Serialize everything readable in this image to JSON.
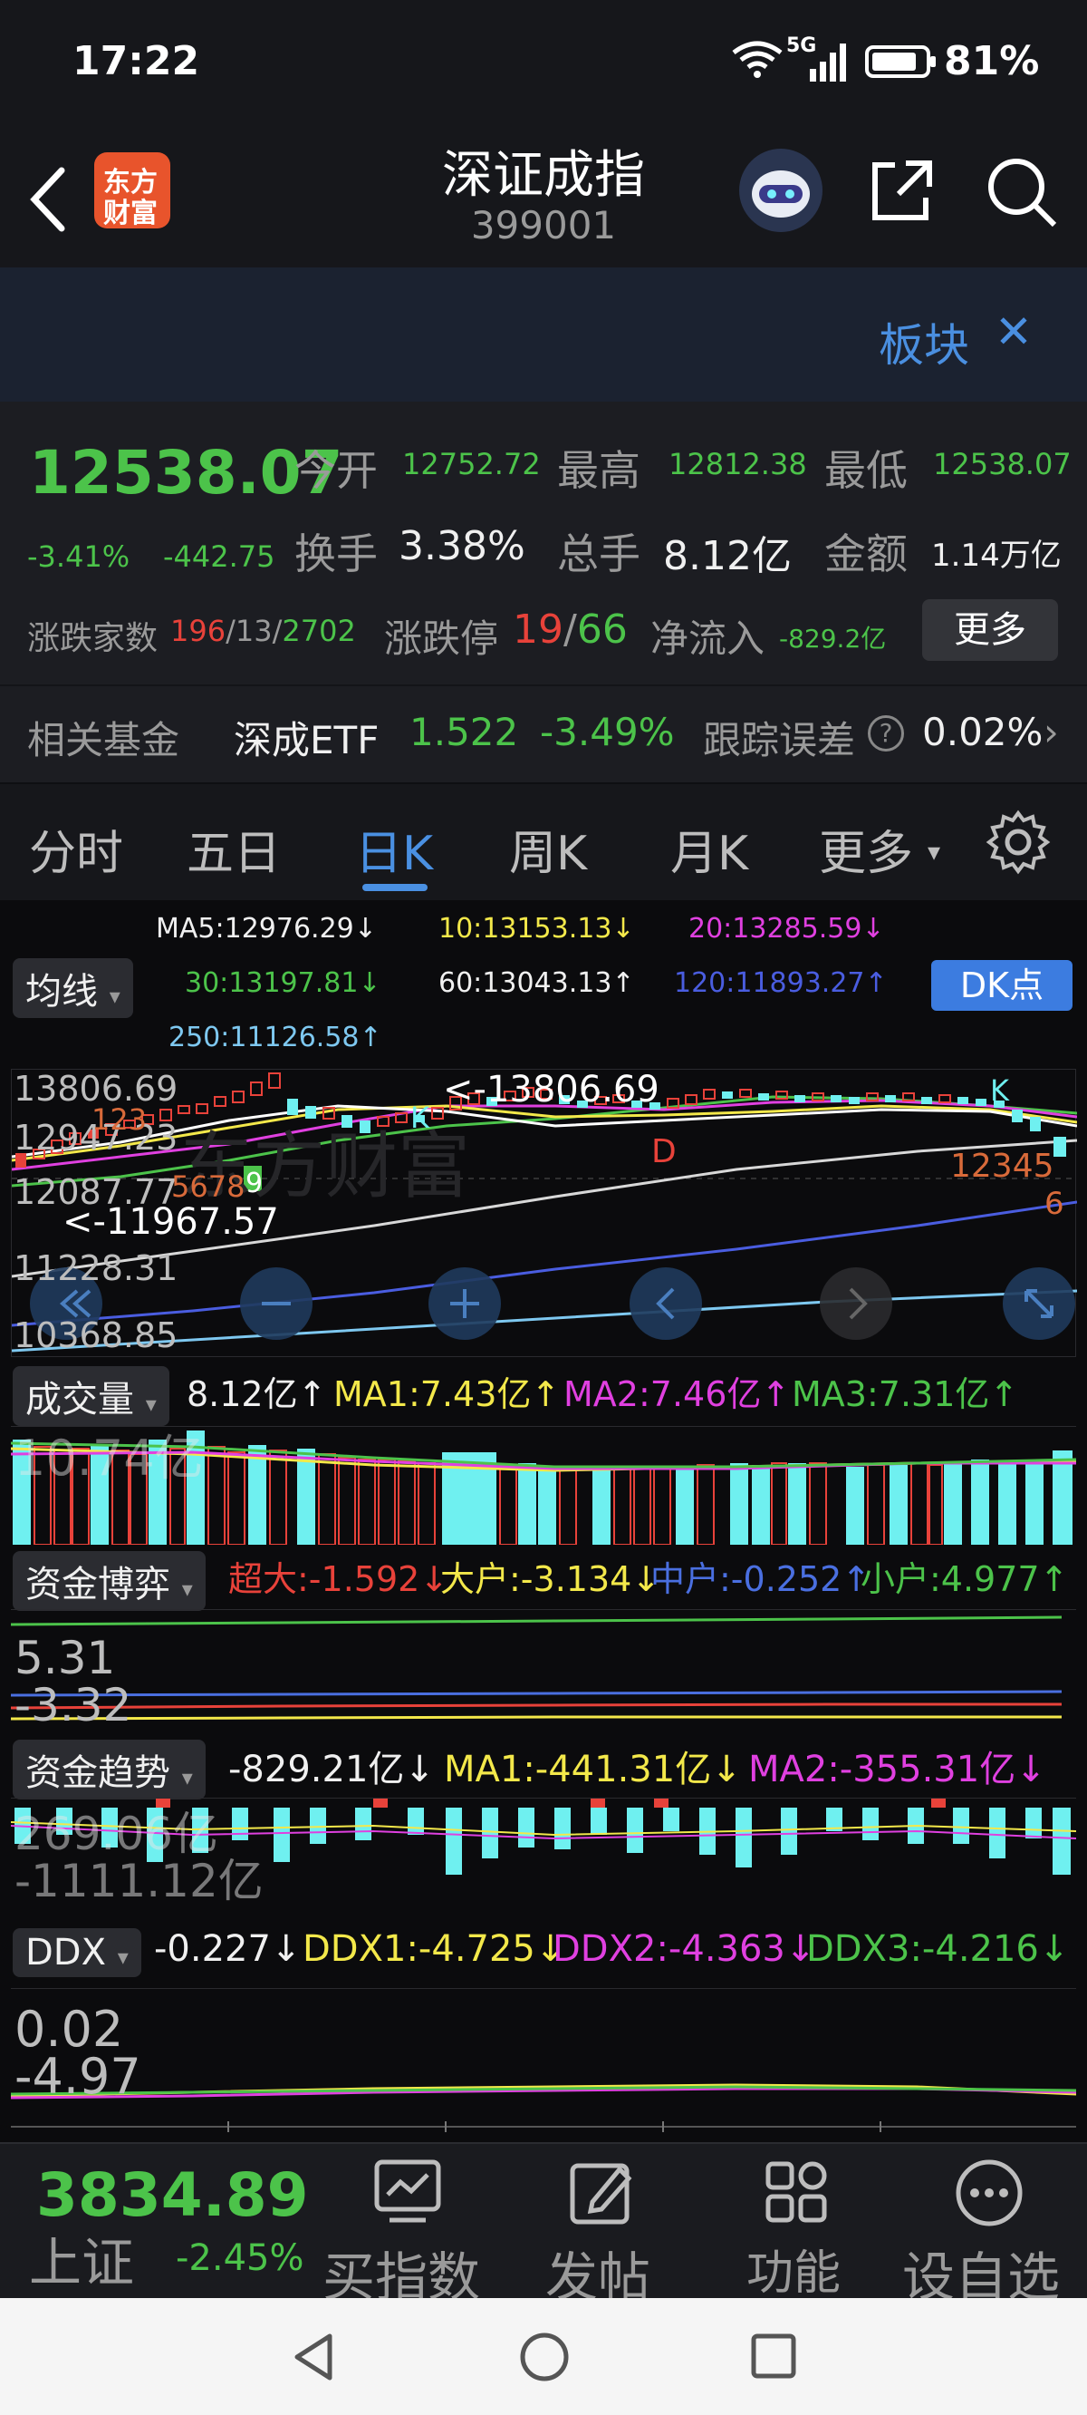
{
  "status": {
    "time": "17:22",
    "battery": "81%",
    "network": "5G"
  },
  "header": {
    "title": "深证成指",
    "code": "399001",
    "logo_line1": "东方",
    "logo_line2": "财富"
  },
  "banner": {
    "text": "板块",
    "close": "✕"
  },
  "quote": {
    "price": "12538.07",
    "change_pct": "-3.41%",
    "change": "-442.75",
    "open_label": "今开",
    "open": "12752.72",
    "high_label": "最高",
    "high": "12812.38",
    "low_label": "最低",
    "low": "12538.07",
    "turnover_label": "换手",
    "turnover": "3.38%",
    "volume_label": "总手",
    "volume": "8.12亿",
    "amount_label": "金额",
    "amount": "1.14万亿",
    "breadth_label": "涨跌家数",
    "breadth_up": "196",
    "breadth_flat": "13",
    "breadth_down": "2702",
    "limit_label": "涨跌停",
    "limit_up": "19",
    "limit_down": "66",
    "netflow_label": "净流入",
    "netflow": "-829.2亿",
    "more": "更多"
  },
  "fund": {
    "label": "相关基金",
    "name": "深成ETF",
    "price": "1.522",
    "pct": "-3.49%",
    "error_label": "跟踪误差",
    "error": "0.02%"
  },
  "tabs": [
    "分时",
    "五日",
    "日K",
    "周K",
    "月K",
    "更多"
  ],
  "ma": {
    "ma5": "MA5:12976.29↓",
    "ma10": "10:13153.13↓",
    "ma20": "20:13285.59↓",
    "ma30": "30:13197.81↓",
    "ma60": "60:13043.13↑",
    "ma120": "120:11893.27↑",
    "ma250": "250:11126.58↑",
    "selector": "均线",
    "dk": "DK点"
  },
  "price_axis": [
    "13806.69",
    "12947.23",
    "12087.77",
    "11228.31",
    "10368.85"
  ],
  "annotations": {
    "high": "<-13806.69",
    "low": "<-11967.57",
    "k1": "K",
    "k2": "K",
    "d": "D",
    "seq1": "123",
    "seq2": "5678",
    "seq3": "9",
    "seq4": "12345",
    "seq5": "6"
  },
  "watermark": "东方财富",
  "volume": {
    "selector": "成交量",
    "value": "8.12亿↑",
    "ma1": "MA1:7.43亿↑",
    "ma2": "MA2:7.46亿↑",
    "ma3": "MA3:7.31亿↑",
    "axis": "10.74亿"
  },
  "capital_game": {
    "selector": "资金博弈",
    "super": "超大:-1.592↓",
    "large": "大户:-3.134↓",
    "mid": "中户:-0.252↑",
    "small": "小户:4.977↑",
    "axis_top": "5.31",
    "axis_bottom": "-3.32"
  },
  "capital_trend": {
    "selector": "资金趋势",
    "value": "-829.21亿↓",
    "ma1": "MA1:-441.31亿↓",
    "ma2": "MA2:-355.31亿↓",
    "axis_top": "269.06亿",
    "axis_bottom": "-1111.12亿"
  },
  "ddx": {
    "selector": "DDX",
    "value": "-0.227↓",
    "ddx1": "DDX1:-4.725↓",
    "ddx2": "DDX2:-4.363↓",
    "ddx3": "DDX3:-4.216↓",
    "axis_top": "0.02",
    "axis_bottom": "-4.97"
  },
  "bottom": {
    "index_price": "3834.89",
    "index_name": "上证",
    "index_pct": "-2.45%",
    "buy": "买指数",
    "post": "发帖",
    "func": "功能",
    "watch": "设自选"
  },
  "colors": {
    "up": "#e8423a",
    "down": "#4cc34a",
    "accent": "#3c7ce0",
    "cyan": "#6ff0f0",
    "yellow": "#f3e84a",
    "magenta": "#e040e0"
  }
}
